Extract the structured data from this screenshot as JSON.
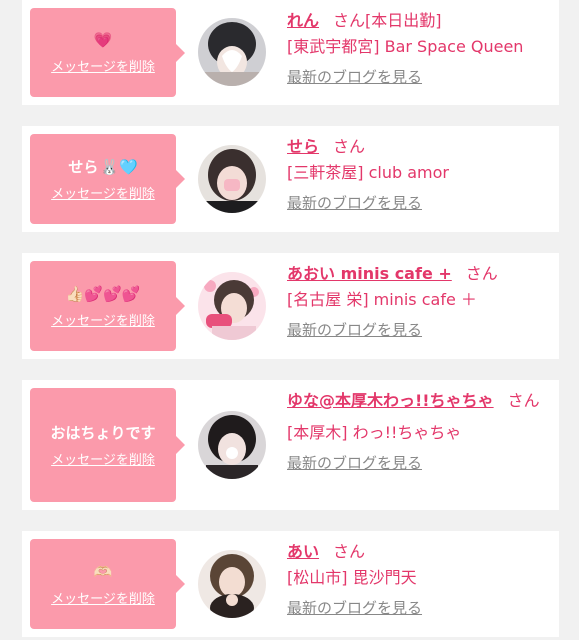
{
  "colors": {
    "accent": "#e3376a",
    "bubble": "#fb9aab",
    "card": "#ffffff",
    "background": "#f1f1f1",
    "muted": "#888888"
  },
  "common": {
    "delete_label": "メッセージを削除",
    "blog_label": "最新のブログを見る",
    "san": "さん"
  },
  "messages": [
    {
      "message_text": "",
      "emoji": "💗",
      "name": "れん",
      "name_suffix": "[本日出勤]",
      "area": "[東武宇都宮]",
      "shop": "Bar Space Queen"
    },
    {
      "message_text": "せら",
      "emoji": "🐰🩵",
      "name": "せら",
      "name_suffix": "",
      "area": "[三軒茶屋]",
      "shop": "club amor"
    },
    {
      "message_text": "",
      "emoji": "👍🏻💕💕💕",
      "name": "あおい minis cafe +",
      "name_suffix": "",
      "area": "[名古屋 栄]",
      "shop": "minis cafe ＋"
    },
    {
      "message_text": "おはちょりです",
      "emoji": "",
      "name": "ゆな@本厚木わっ!!ちゃちゃ",
      "name_suffix": "",
      "area": "[本厚木]",
      "shop": "わっ!!ちゃちゃ"
    },
    {
      "message_text": "",
      "emoji": "🫶🏻",
      "name": "あい",
      "name_suffix": "",
      "area": "[松山市]",
      "shop": "毘沙門天"
    }
  ]
}
